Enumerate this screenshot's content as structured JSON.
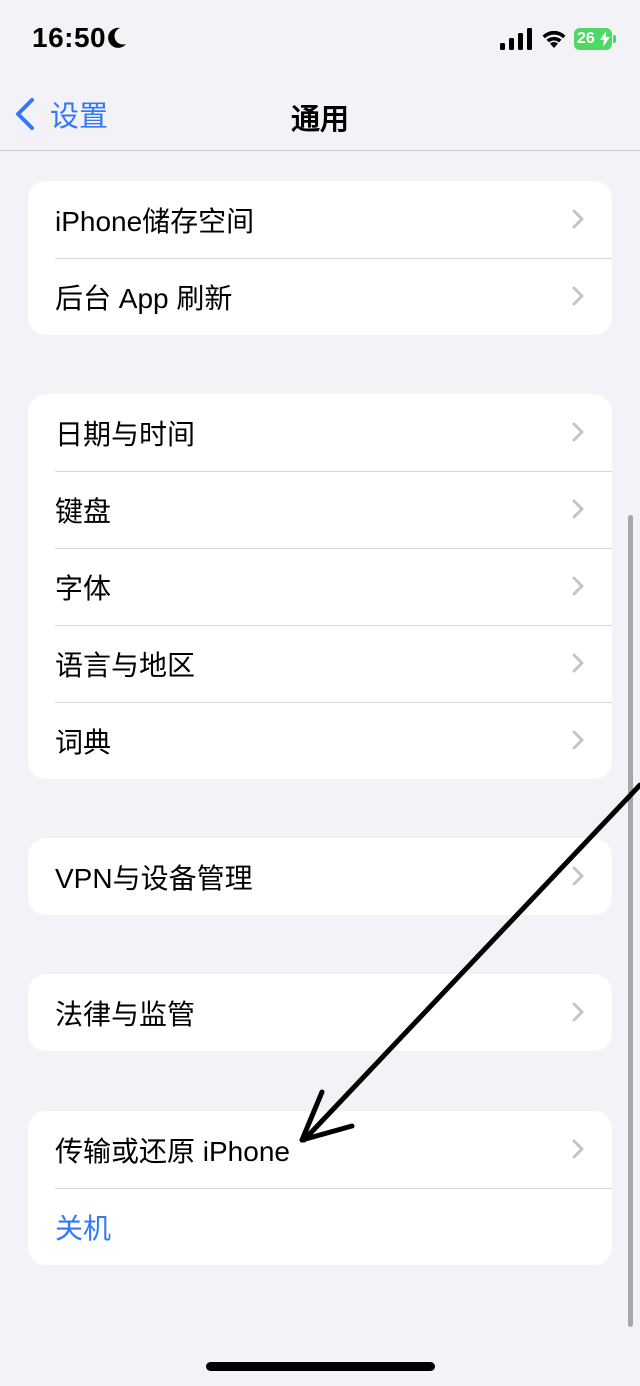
{
  "status_bar": {
    "time": "16:50",
    "battery_level": "26",
    "battery_color": "#4cd964",
    "icons": [
      "moon-icon",
      "signal-icon",
      "wifi-icon",
      "bolt-icon"
    ]
  },
  "nav": {
    "back_label": "设置",
    "title": "通用",
    "accent_color": "#3478f6"
  },
  "groups": [
    {
      "items": [
        {
          "label": "iPhone储存空间"
        },
        {
          "label": "后台 App 刷新"
        }
      ]
    },
    {
      "items": [
        {
          "label": "日期与时间"
        },
        {
          "label": "键盘"
        },
        {
          "label": "字体"
        },
        {
          "label": "语言与地区"
        },
        {
          "label": "词典"
        }
      ]
    },
    {
      "items": [
        {
          "label": "VPN与设备管理"
        }
      ]
    },
    {
      "items": [
        {
          "label": "法律与监管"
        }
      ]
    },
    {
      "items": [
        {
          "label": "传输或还原 iPhone"
        },
        {
          "label": "关机"
        }
      ]
    }
  ]
}
